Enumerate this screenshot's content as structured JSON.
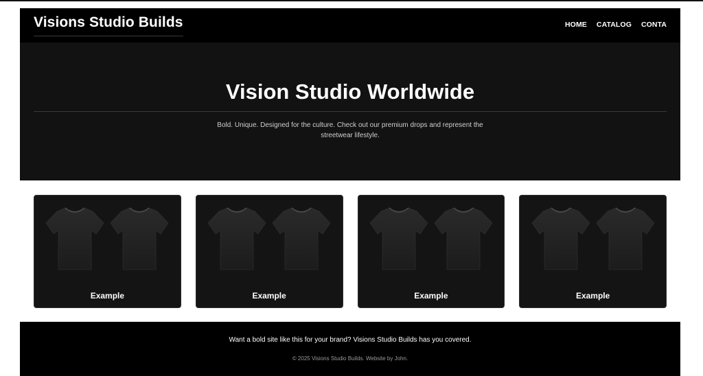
{
  "header": {
    "brand": "Visions Studio Builds",
    "nav": [
      "HOME",
      "CATALOG",
      "CONTACT"
    ]
  },
  "hero": {
    "title": "Vision Studio Worldwide",
    "subtitle": "Bold. Unique. Designed for the culture. Check out our premium drops and represent the streetwear lifestyle."
  },
  "products": [
    {
      "label": "Example",
      "image": "two-black-tshirts"
    },
    {
      "label": "Example",
      "image": "two-black-tshirts"
    },
    {
      "label": "Example",
      "image": "two-black-tshirts"
    },
    {
      "label": "Example",
      "image": "two-black-tshirts"
    }
  ],
  "footer": {
    "cta": "Want a bold site like this for your brand? Visions Studio Builds has you covered.",
    "copyright": "© 2025 Visions Studio Builds. Website by John."
  },
  "colors": {
    "header_bg": "#000000",
    "hero_bg": "#121212",
    "card_bg": "#141414",
    "text": "#ffffff"
  }
}
